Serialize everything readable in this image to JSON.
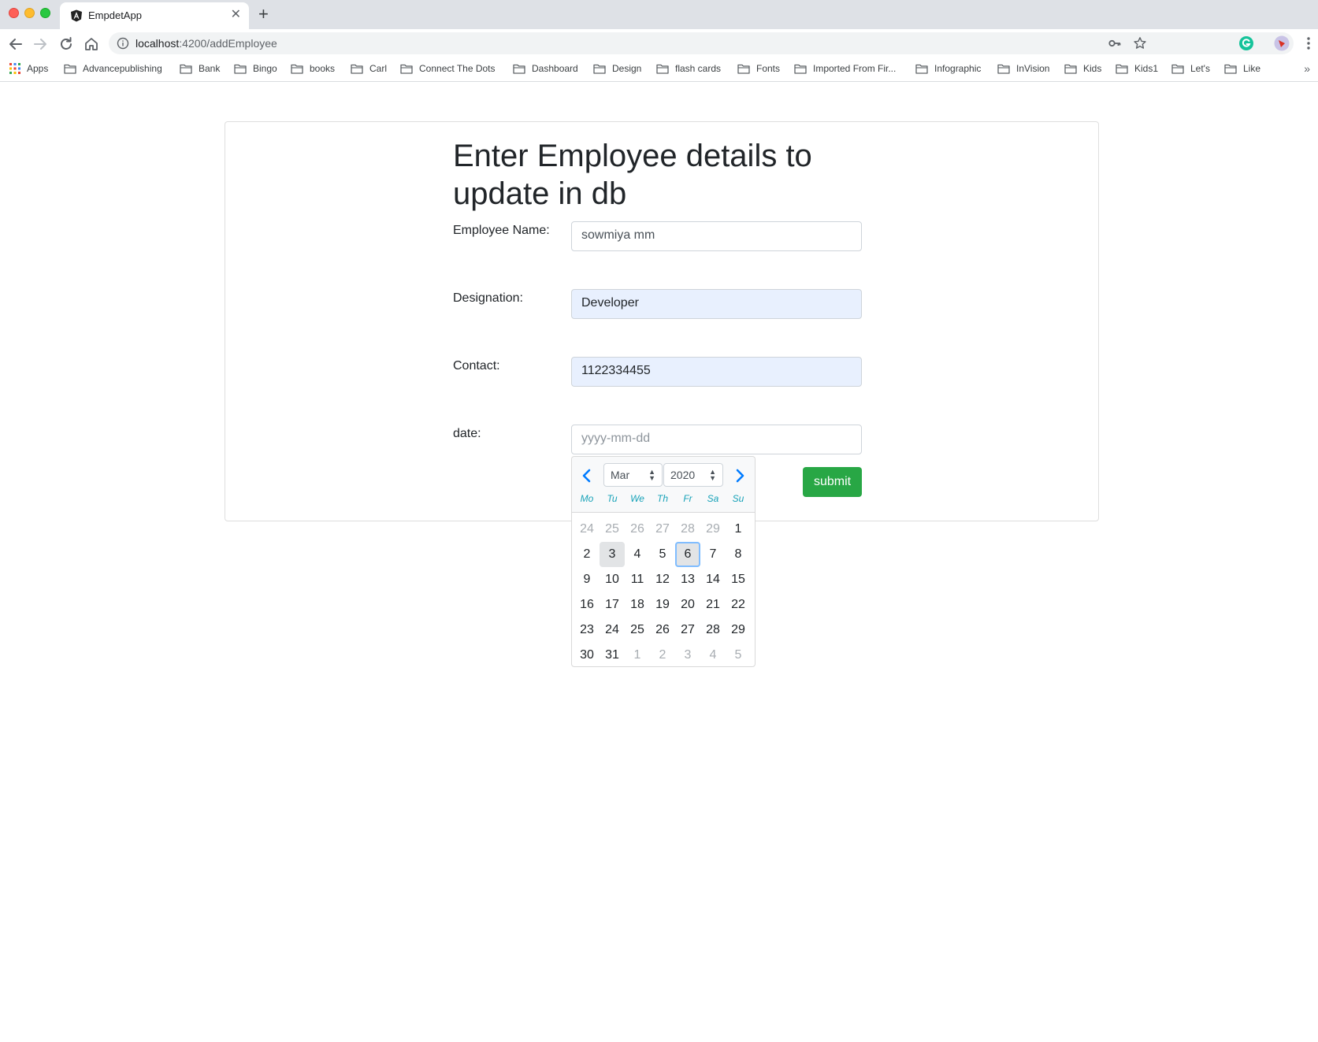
{
  "browser": {
    "tab_title": "EmpdetApp",
    "tab_close": "✕",
    "new_tab": "+",
    "url_host": "localhost",
    "url_path": ":4200/addEmployee",
    "more_bookmarks": "»",
    "bookmarks": [
      "Apps",
      "Advancepublishing",
      "Bank",
      "Bingo",
      "books",
      "Carl",
      "Connect The Dots",
      "Dashboard",
      "Design",
      "flash cards",
      "Fonts",
      "Imported From Fir...",
      "Infographic",
      "InVision",
      "Kids",
      "Kids1",
      "Let's",
      "Like"
    ]
  },
  "form": {
    "heading": "Enter Employee details to update in db",
    "name_label": "Employee Name:",
    "name_value": "sowmiya mm",
    "designation_label": "Designation:",
    "designation_value": "Developer",
    "contact_label": "Contact:",
    "contact_value": "1122334455",
    "date_label": "date:",
    "date_placeholder": "yyyy-mm-dd",
    "submit_label": "submit"
  },
  "datepicker": {
    "month": "Mar",
    "year": "2020",
    "weekdays": [
      "Mo",
      "Tu",
      "We",
      "Th",
      "Fr",
      "Sa",
      "Su"
    ],
    "weeks": [
      [
        "24",
        "25",
        "26",
        "27",
        "28",
        "29",
        "1"
      ],
      [
        "2",
        "3",
        "4",
        "5",
        "6",
        "7",
        "8"
      ],
      [
        "9",
        "10",
        "11",
        "12",
        "13",
        "14",
        "15"
      ],
      [
        "16",
        "17",
        "18",
        "19",
        "20",
        "21",
        "22"
      ],
      [
        "23",
        "24",
        "25",
        "26",
        "27",
        "28",
        "29"
      ],
      [
        "30",
        "31",
        "1",
        "2",
        "3",
        "4",
        "5"
      ]
    ],
    "today": "3",
    "focused": "6"
  },
  "colors": {
    "submit": "#28a745",
    "autofill": "#e8f0fe",
    "datepicker_arrow": "#007bff",
    "weekday_text": "#17a2b8",
    "focus_ring": "#80bdff"
  }
}
